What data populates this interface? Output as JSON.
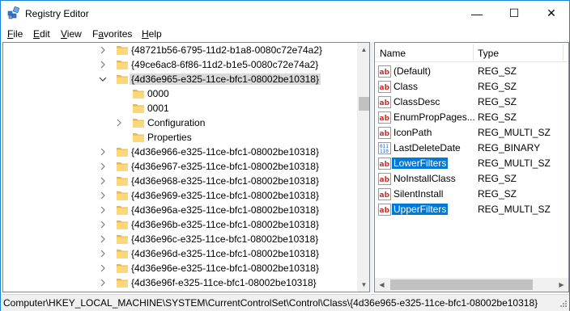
{
  "window": {
    "title": "Registry Editor",
    "accent_border": "#1883d7",
    "minimize_glyph": "—",
    "maximize_glyph": "☐",
    "close_glyph": "✕"
  },
  "menu": [
    {
      "label": "File"
    },
    {
      "label": "Edit"
    },
    {
      "label": "View"
    },
    {
      "label": "Favorites"
    },
    {
      "label": "Help"
    }
  ],
  "tree": {
    "rows": [
      {
        "label": "{48721b56-6795-11d2-b1a8-0080c72e74a2}",
        "expander": "collapsed",
        "selected": false
      },
      {
        "label": "{49ce6ac8-6f86-11d2-b1e5-0080c72e74a2}",
        "expander": "collapsed",
        "selected": false
      },
      {
        "label": "{4d36e965-e325-11ce-bfc1-08002be10318}",
        "expander": "expanded",
        "selected": true
      },
      {
        "label": "0000",
        "expander": "none",
        "selected": false
      },
      {
        "label": "0001",
        "expander": "none",
        "selected": false
      },
      {
        "label": "Configuration",
        "expander": "collapsed",
        "selected": false
      },
      {
        "label": "Properties",
        "expander": "none",
        "selected": false
      },
      {
        "label": "{4d36e966-e325-11ce-bfc1-08002be10318}",
        "expander": "collapsed",
        "selected": false
      },
      {
        "label": "{4d36e967-e325-11ce-bfc1-08002be10318}",
        "expander": "collapsed",
        "selected": false
      },
      {
        "label": "{4d36e968-e325-11ce-bfc1-08002be10318}",
        "expander": "collapsed",
        "selected": false
      },
      {
        "label": "{4d36e969-e325-11ce-bfc1-08002be10318}",
        "expander": "collapsed",
        "selected": false
      },
      {
        "label": "{4d36e96a-e325-11ce-bfc1-08002be10318}",
        "expander": "collapsed",
        "selected": false
      },
      {
        "label": "{4d36e96b-e325-11ce-bfc1-08002be10318}",
        "expander": "collapsed",
        "selected": false
      },
      {
        "label": "{4d36e96c-e325-11ce-bfc1-08002be10318}",
        "expander": "collapsed",
        "selected": false
      },
      {
        "label": "{4d36e96d-e325-11ce-bfc1-08002be10318}",
        "expander": "collapsed",
        "selected": false
      },
      {
        "label": "{4d36e96e-e325-11ce-bfc1-08002be10318}",
        "expander": "collapsed",
        "selected": false
      },
      {
        "label": "{4d36e96f-e325-11ce-bfc1-08002be10318}",
        "expander": "collapsed",
        "selected": false
      }
    ]
  },
  "values": {
    "columns": {
      "name": "Name",
      "type": "Type"
    },
    "rows": [
      {
        "name": "(Default)",
        "type": "REG_SZ",
        "icon": "string-value-icon",
        "highlight": false
      },
      {
        "name": "Class",
        "type": "REG_SZ",
        "icon": "string-value-icon",
        "highlight": false
      },
      {
        "name": "ClassDesc",
        "type": "REG_SZ",
        "icon": "string-value-icon",
        "highlight": false
      },
      {
        "name": "EnumPropPages...",
        "type": "REG_SZ",
        "icon": "string-value-icon",
        "highlight": false
      },
      {
        "name": "IconPath",
        "type": "REG_MULTI_SZ",
        "icon": "string-value-icon",
        "highlight": false
      },
      {
        "name": "LastDeleteDate",
        "type": "REG_BINARY",
        "icon": "binary-value-icon",
        "highlight": false
      },
      {
        "name": "LowerFilters",
        "type": "REG_MULTI_SZ",
        "icon": "string-value-icon",
        "highlight": true
      },
      {
        "name": "NoInstallClass",
        "type": "REG_SZ",
        "icon": "string-value-icon",
        "highlight": false
      },
      {
        "name": "SilentInstall",
        "type": "REG_SZ",
        "icon": "string-value-icon",
        "highlight": false
      },
      {
        "name": "UpperFilters",
        "type": "REG_MULTI_SZ",
        "icon": "string-value-icon",
        "highlight": true
      }
    ],
    "highlight_color": "#0078d7"
  },
  "status": {
    "path": "Computer\\HKEY_LOCAL_MACHINE\\SYSTEM\\CurrentControlSet\\Control\\Class\\{4d36e965-e325-11ce-bfc1-08002be10318}"
  }
}
